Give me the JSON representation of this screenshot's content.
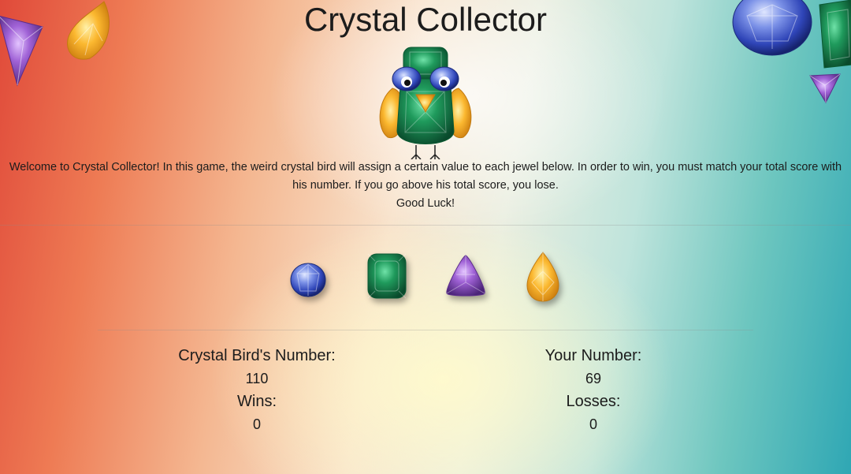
{
  "title": "Crystal Collector",
  "intro": {
    "line1": "Welcome to Crystal Collector! In this game, the weird crystal bird will assign a certain value to each jewel below. In order to win, you must match your total score with his number. If you go above his total score, you lose.",
    "line2": "Good Luck!"
  },
  "jewels": [
    {
      "name": "blue-sapphire",
      "color": "#3e55c4"
    },
    {
      "name": "green-emerald",
      "color": "#1f8a55"
    },
    {
      "name": "purple-amethyst",
      "color": "#8b4fc2"
    },
    {
      "name": "yellow-citrine",
      "color": "#f4a623"
    }
  ],
  "stats": {
    "bird_label": "Crystal Bird's Number:",
    "bird_value": "110",
    "wins_label": "Wins:",
    "wins_value": "0",
    "your_label": "Your Number:",
    "your_value": "69",
    "losses_label": "Losses:",
    "losses_value": "0"
  },
  "colors": {
    "left_background": "#e04a3a",
    "right_background": "#2fa7b4",
    "center_background": "#fff6cf"
  }
}
